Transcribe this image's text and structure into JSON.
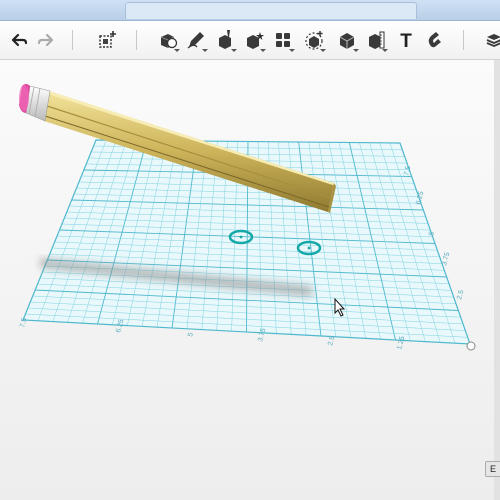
{
  "toolbar": {
    "buttons": [
      {
        "name": "undo-icon"
      },
      {
        "name": "redo-icon"
      },
      {
        "name": "add-object-icon"
      },
      {
        "name": "primitives-icon"
      },
      {
        "name": "sketch-icon"
      },
      {
        "name": "construct-icon"
      },
      {
        "name": "modify-icon"
      },
      {
        "name": "pattern-icon"
      },
      {
        "name": "grouping-icon"
      },
      {
        "name": "combine-icon"
      },
      {
        "name": "measure-icon"
      },
      {
        "name": "text-icon"
      },
      {
        "name": "snap-icon"
      },
      {
        "name": "material-icon"
      }
    ],
    "text_glyph": "T"
  },
  "grid": {
    "bottom_ticks": [
      "7.5",
      "6.25",
      "5",
      "3.75",
      "2.5",
      "1.25"
    ],
    "right_ticks": [
      "2.5",
      "3.75",
      "5",
      "6.25",
      "7.5"
    ]
  },
  "status": {
    "button_label": "E"
  },
  "colors": {
    "grid_line": "#7fd2e2",
    "grid_major": "#4fb8cd",
    "sketch_circle": "#14a8a8",
    "pencil_body": "#d4bd62",
    "eraser": "#e04aa0"
  }
}
